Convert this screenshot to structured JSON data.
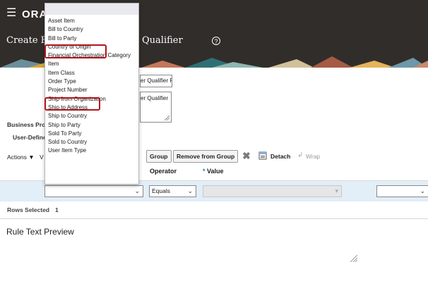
{
  "header": {
    "menu_icon": "hamburger-icon",
    "logo": "ORA",
    "title_left": "Create Fi",
    "title_right": "Qualifier",
    "help_icon": "question-circle-icon",
    "background": "#312d2a"
  },
  "form": {
    "description_value": "er Qualifier F",
    "text_value": "er Qualifier",
    "business_process_label": "Business Pro",
    "user_defined_label": "User-Define"
  },
  "toolbar": {
    "actions_label": "Actions ▼",
    "view_label": "V",
    "group_label": "Group",
    "remove_label": "Remove from Group",
    "detach_label": "Detach",
    "wrap_label": "Wrap"
  },
  "table": {
    "columns": {
      "operator": "Operator",
      "value_required": "*",
      "value": "Value"
    },
    "row": {
      "attribute": "",
      "operator": "Equals",
      "value": "",
      "extra": ""
    },
    "rows_selected_label": "Rows Selected",
    "rows_selected_count": "1"
  },
  "preview": {
    "title": "Rule Text Preview"
  },
  "dropdown": {
    "items": [
      "Asset Item",
      "Bill to Country",
      "Bill to Party",
      "Country of Origin",
      "Financial Orchestration Category",
      "Item",
      "Item Class",
      "Order Type",
      "Project Number",
      "Ship from Organization",
      "Ship to Address",
      "Ship to Country",
      "Ship to Party",
      "Sold To Party",
      "Sold to Country",
      "User Item Type"
    ],
    "highlighted": [
      "Country of Origin",
      "Project Number"
    ],
    "highlight_color": "#b0141a"
  },
  "colors": {
    "selected_row": "#e2eef8",
    "required_asterisk": "#2a7ab9"
  }
}
